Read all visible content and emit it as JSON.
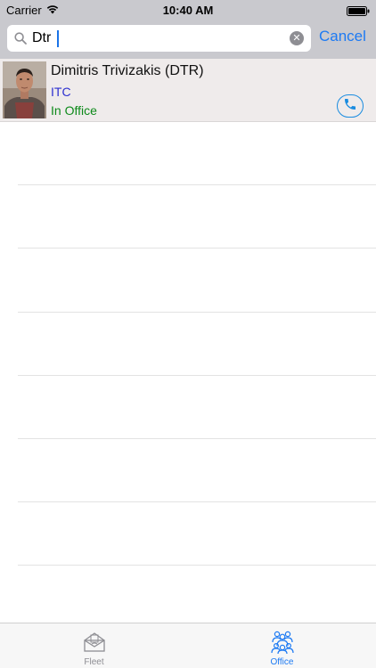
{
  "status_bar": {
    "carrier": "Carrier",
    "time": "10:40 AM"
  },
  "search": {
    "value": "Dtr",
    "cancel_label": "Cancel"
  },
  "results": [
    {
      "name": "Dimitris Trivizakis (DTR)",
      "department": "ITC",
      "status": "In Office"
    }
  ],
  "tabs": [
    {
      "label": "Fleet",
      "selected": false
    },
    {
      "label": "Office",
      "selected": true
    }
  ],
  "colors": {
    "accent": "#1d7af3",
    "department": "#2c2fd0",
    "status_in_office": "#0d8a1a",
    "bar_background": "#c9c9ce",
    "row_background": "#efebeb"
  }
}
